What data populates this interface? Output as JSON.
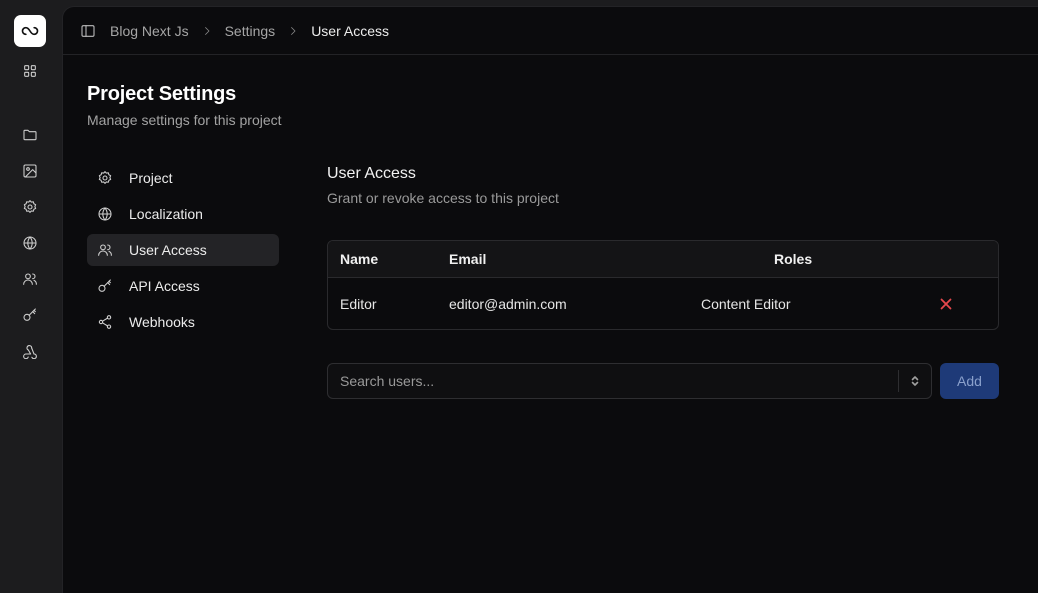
{
  "breadcrumb": [
    "Blog Next Js",
    "Settings",
    "User Access"
  ],
  "page": {
    "title": "Project Settings",
    "subtitle": "Manage settings for this project"
  },
  "nav": [
    {
      "label": "Project",
      "icon": "gear-icon",
      "active": false
    },
    {
      "label": "Localization",
      "icon": "globe-icon",
      "active": false
    },
    {
      "label": "User Access",
      "icon": "users-icon",
      "active": true
    },
    {
      "label": "API Access",
      "icon": "key-icon",
      "active": false
    },
    {
      "label": "Webhooks",
      "icon": "share-icon",
      "active": false
    }
  ],
  "section": {
    "title": "User Access",
    "subtitle": "Grant or revoke access to this project"
  },
  "table": {
    "headers": [
      "Name",
      "Email",
      "Roles"
    ],
    "rows": [
      {
        "name": "Editor",
        "email": "editor@admin.com",
        "role": "Content Editor"
      }
    ]
  },
  "search": {
    "placeholder": "Search users...",
    "value": ""
  },
  "add_label": "Add",
  "rail_icons": [
    "logo-icon",
    "grid-icon",
    "folder-icon",
    "image-icon",
    "gear-icon",
    "globe-icon",
    "users-icon",
    "key-icon",
    "webhook-icon"
  ],
  "colors": {
    "accent": "#1e3a78",
    "danger": "#e5484d"
  }
}
